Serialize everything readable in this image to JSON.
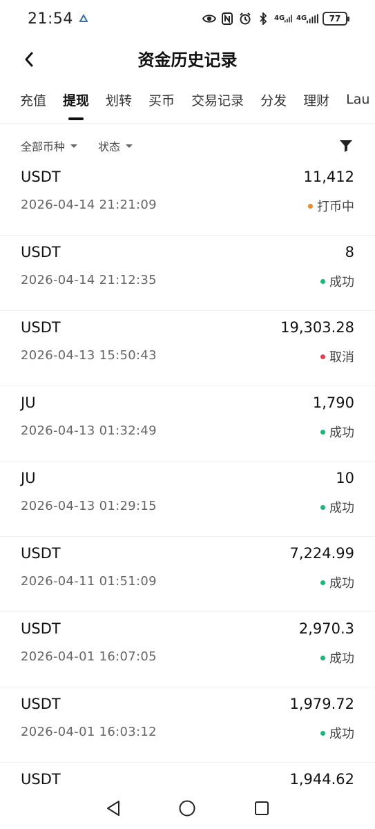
{
  "status_bar": {
    "time": "21:54",
    "net1": "4G",
    "net2": "4G",
    "battery": "77"
  },
  "header": {
    "title": "资金历史记录"
  },
  "tabs": [
    {
      "label": "充值"
    },
    {
      "label": "提现"
    },
    {
      "label": "划转"
    },
    {
      "label": "买币"
    },
    {
      "label": "交易记录"
    },
    {
      "label": "分发"
    },
    {
      "label": "理财"
    },
    {
      "label": "Lau"
    }
  ],
  "filters": {
    "currency": "全部币种",
    "status": "状态"
  },
  "colors": {
    "pending": "#e8892b",
    "success": "#1fb57a",
    "cancel": "#e0424f"
  },
  "records": [
    {
      "asset": "USDT",
      "amount": "11,412",
      "time": "2026-04-14 21:21:09",
      "status": "打币中"
    },
    {
      "asset": "USDT",
      "amount": "8",
      "time": "2026-04-14 21:12:35",
      "status": "成功"
    },
    {
      "asset": "USDT",
      "amount": "19,303.28",
      "time": "2026-04-13 15:50:43",
      "status": "取消"
    },
    {
      "asset": "JU",
      "amount": "1,790",
      "time": "2026-04-13 01:32:49",
      "status": "成功"
    },
    {
      "asset": "JU",
      "amount": "10",
      "time": "2026-04-13 01:29:15",
      "status": "成功"
    },
    {
      "asset": "USDT",
      "amount": "7,224.99",
      "time": "2026-04-11 01:51:09",
      "status": "成功"
    },
    {
      "asset": "USDT",
      "amount": "2,970.3",
      "time": "2026-04-01 16:07:05",
      "status": "成功"
    },
    {
      "asset": "USDT",
      "amount": "1,979.72",
      "time": "2026-04-01 16:03:12",
      "status": "成功"
    },
    {
      "asset": "USDT",
      "amount": "1,944.62",
      "time": "",
      "status": ""
    }
  ]
}
